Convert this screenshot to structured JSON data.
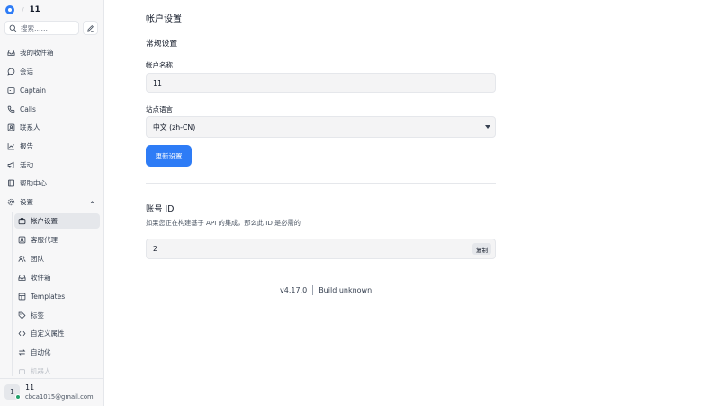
{
  "sidebar": {
    "account_name": "11",
    "search_placeholder": "搜索……",
    "nav": {
      "inbox": "我的收件箱",
      "conversations": "会话",
      "captain": "Captain",
      "calls": "Calls",
      "contacts": "联系人",
      "reports": "报告",
      "campaigns": "活动",
      "help_center": "帮助中心",
      "settings": "设置"
    },
    "settings_items": {
      "account_settings": "帐户设置",
      "agents": "客服代理",
      "teams": "团队",
      "inboxes": "收件箱",
      "templates": "Templates",
      "labels": "标签",
      "custom_attributes": "自定义属性",
      "automation": "自动化",
      "bots": "机器人"
    },
    "user": {
      "avatar_initial": "1",
      "name": "11",
      "email": "cbca1015@gmail.com",
      "status_color": "#22a06b"
    }
  },
  "main": {
    "page_title": "帐户设置",
    "general_section_title": "常规设置",
    "account_name_label": "帐户名称",
    "account_name_value": "11",
    "site_language_label": "站点语言",
    "site_language_value": "中文 (zh-CN)",
    "update_button": "更新设置",
    "account_id_title": "账号 ID",
    "account_id_description": "如果您正在构建基于 API 的集成，那么此 ID 是必需的",
    "account_id_value": "2",
    "copy_button": "复制",
    "version": "v4.17.0",
    "build": "Build unknown"
  },
  "colors": {
    "accent": "#2e7cf6",
    "sidebar_bg": "#f7f7f8",
    "active_item_bg": "#e5e7eb"
  }
}
